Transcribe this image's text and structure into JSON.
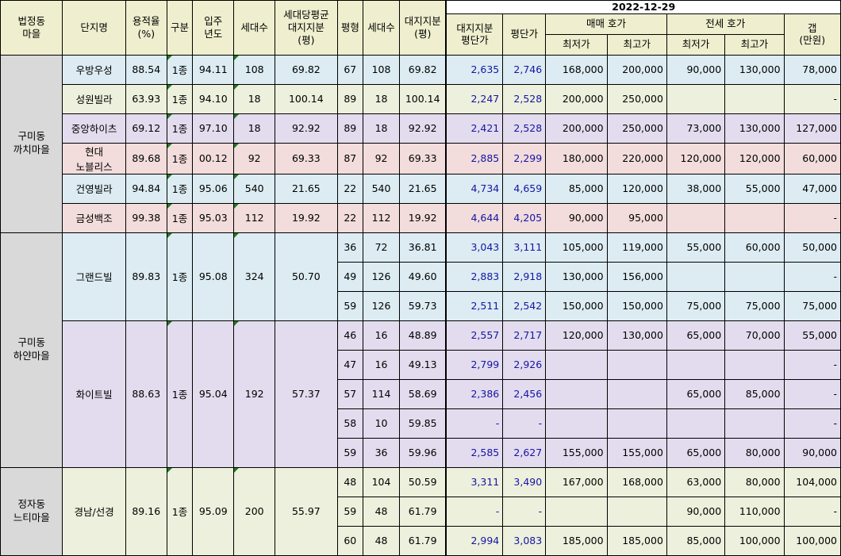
{
  "header": {
    "region": "법정동\n마을",
    "complex": "단지명",
    "far": "용적율\n(%)",
    "zone": "구분",
    "move_in": "입주\n년도",
    "households": "세대수",
    "avg_land": "세대당평균\n대지지분\n(평)",
    "pyeong": "평형",
    "unit_households": "세대수",
    "land_share": "대지지분\n(평)",
    "land_price": "대지지분\n평단가",
    "pyeong_price": "평단가",
    "date": "2022-12-29",
    "sale": "매매 호가",
    "jeonse": "전세 호가",
    "gap": "갭\n(만원)",
    "min": "최저가",
    "max": "최고가"
  },
  "regions": [
    {
      "name": "구미동\n까치마을"
    },
    {
      "name": "구미동\n하얀마을"
    },
    {
      "name": "정자동\n느티마을"
    }
  ],
  "complexes": [
    {
      "name": "우방우성",
      "far": "88.54",
      "zone": "1종",
      "year": "94.11",
      "households": "108",
      "avg_land": "69.82",
      "color": "#dcecf2",
      "rows": [
        {
          "pyeong": "67",
          "households": "108",
          "land": "69.82",
          "land_price": "2,635",
          "price": "2,746",
          "sale_min": "168,000",
          "sale_max": "200,000",
          "jeonse_min": "90,000",
          "jeonse_max": "130,000",
          "gap": "78,000"
        }
      ]
    },
    {
      "name": "성원빌라",
      "far": "63.93",
      "zone": "1종",
      "year": "94.10",
      "households": "18",
      "avg_land": "100.14",
      "color": "#edf0dc",
      "rows": [
        {
          "pyeong": "89",
          "households": "18",
          "land": "100.14",
          "land_price": "2,247",
          "price": "2,528",
          "sale_min": "200,000",
          "sale_max": "250,000",
          "jeonse_min": "",
          "jeonse_max": "",
          "gap": "-"
        }
      ]
    },
    {
      "name": "중앙하이츠",
      "far": "69.12",
      "zone": "1종",
      "year": "97.10",
      "households": "18",
      "avg_land": "92.92",
      "color": "#e3dcee",
      "rows": [
        {
          "pyeong": "89",
          "households": "18",
          "land": "92.92",
          "land_price": "2,421",
          "price": "2,528",
          "sale_min": "200,000",
          "sale_max": "250,000",
          "jeonse_min": "73,000",
          "jeonse_max": "130,000",
          "gap": "127,000"
        }
      ]
    },
    {
      "name": "현대\n노블리스",
      "far": "89.68",
      "zone": "1종",
      "year": "00.12",
      "households": "92",
      "avg_land": "69.33",
      "color": "#f2dcdc",
      "rows": [
        {
          "pyeong": "87",
          "households": "92",
          "land": "69.33",
          "land_price": "2,885",
          "price": "2,299",
          "sale_min": "180,000",
          "sale_max": "220,000",
          "jeonse_min": "120,000",
          "jeonse_max": "120,000",
          "gap": "60,000"
        }
      ]
    },
    {
      "name": "건영빌라",
      "far": "94.84",
      "zone": "1종",
      "year": "95.06",
      "households": "540",
      "avg_land": "21.65",
      "color": "#dcecf2",
      "rows": [
        {
          "pyeong": "22",
          "households": "540",
          "land": "21.65",
          "land_price": "4,734",
          "price": "4,659",
          "sale_min": "85,000",
          "sale_max": "120,000",
          "jeonse_min": "38,000",
          "jeonse_max": "55,000",
          "gap": "47,000"
        }
      ]
    },
    {
      "name": "금성백조",
      "far": "99.38",
      "zone": "1종",
      "year": "95.03",
      "households": "112",
      "avg_land": "19.92",
      "color": "#f2dcdc",
      "rows": [
        {
          "pyeong": "22",
          "households": "112",
          "land": "19.92",
          "land_price": "4,644",
          "price": "4,205",
          "sale_min": "90,000",
          "sale_max": "95,000",
          "jeonse_min": "",
          "jeonse_max": "",
          "gap": "-"
        }
      ]
    },
    {
      "name": "그랜드빌",
      "far": "89.83",
      "zone": "1종",
      "year": "95.08",
      "households": "324",
      "avg_land": "50.70",
      "color": "#dcecf2",
      "rows": [
        {
          "pyeong": "36",
          "households": "72",
          "land": "36.81",
          "land_price": "3,043",
          "price": "3,111",
          "sale_min": "105,000",
          "sale_max": "119,000",
          "jeonse_min": "55,000",
          "jeonse_max": "60,000",
          "gap": "50,000"
        },
        {
          "pyeong": "49",
          "households": "126",
          "land": "49.60",
          "land_price": "2,883",
          "price": "2,918",
          "sale_min": "130,000",
          "sale_max": "156,000",
          "jeonse_min": "",
          "jeonse_max": "",
          "gap": "-"
        },
        {
          "pyeong": "59",
          "households": "126",
          "land": "59.73",
          "land_price": "2,511",
          "price": "2,542",
          "sale_min": "150,000",
          "sale_max": "150,000",
          "jeonse_min": "75,000",
          "jeonse_max": "75,000",
          "gap": "75,000"
        }
      ]
    },
    {
      "name": "화이트빌",
      "far": "88.63",
      "zone": "1종",
      "year": "95.04",
      "households": "192",
      "avg_land": "57.37",
      "color": "#e3dcee",
      "rows": [
        {
          "pyeong": "46",
          "households": "16",
          "land": "48.89",
          "land_price": "2,557",
          "price": "2,717",
          "sale_min": "120,000",
          "sale_max": "130,000",
          "jeonse_min": "65,000",
          "jeonse_max": "70,000",
          "gap": "55,000"
        },
        {
          "pyeong": "47",
          "households": "16",
          "land": "49.13",
          "land_price": "2,799",
          "price": "2,926",
          "sale_min": "",
          "sale_max": "",
          "jeonse_min": "",
          "jeonse_max": "",
          "gap": "-"
        },
        {
          "pyeong": "57",
          "households": "114",
          "land": "58.69",
          "land_price": "2,386",
          "price": "2,456",
          "sale_min": "",
          "sale_max": "",
          "jeonse_min": "65,000",
          "jeonse_max": "85,000",
          "gap": "-"
        },
        {
          "pyeong": "58",
          "households": "10",
          "land": "59.85",
          "land_price": "-",
          "price": "-",
          "sale_min": "",
          "sale_max": "",
          "jeonse_min": "",
          "jeonse_max": "",
          "gap": "-"
        },
        {
          "pyeong": "59",
          "households": "36",
          "land": "59.96",
          "land_price": "2,585",
          "price": "2,627",
          "sale_min": "155,000",
          "sale_max": "155,000",
          "jeonse_min": "65,000",
          "jeonse_max": "80,000",
          "gap": "90,000"
        }
      ]
    },
    {
      "name": "경남/선경",
      "far": "89.16",
      "zone": "1종",
      "year": "95.09",
      "households": "200",
      "avg_land": "55.97",
      "color": "#edf0dc",
      "rows": [
        {
          "pyeong": "48",
          "households": "104",
          "land": "50.59",
          "land_price": "3,311",
          "price": "3,490",
          "sale_min": "167,000",
          "sale_max": "168,000",
          "jeonse_min": "63,000",
          "jeonse_max": "80,000",
          "gap": "104,000"
        },
        {
          "pyeong": "59",
          "households": "48",
          "land": "61.79",
          "land_price": "-",
          "price": "-",
          "sale_min": "",
          "sale_max": "",
          "jeonse_min": "90,000",
          "jeonse_max": "110,000",
          "gap": "-"
        },
        {
          "pyeong": "60",
          "households": "48",
          "land": "61.79",
          "land_price": "2,994",
          "price": "3,083",
          "sale_min": "185,000",
          "sale_max": "185,000",
          "jeonse_min": "85,000",
          "jeonse_max": "100,000",
          "gap": "100,000"
        }
      ]
    }
  ]
}
